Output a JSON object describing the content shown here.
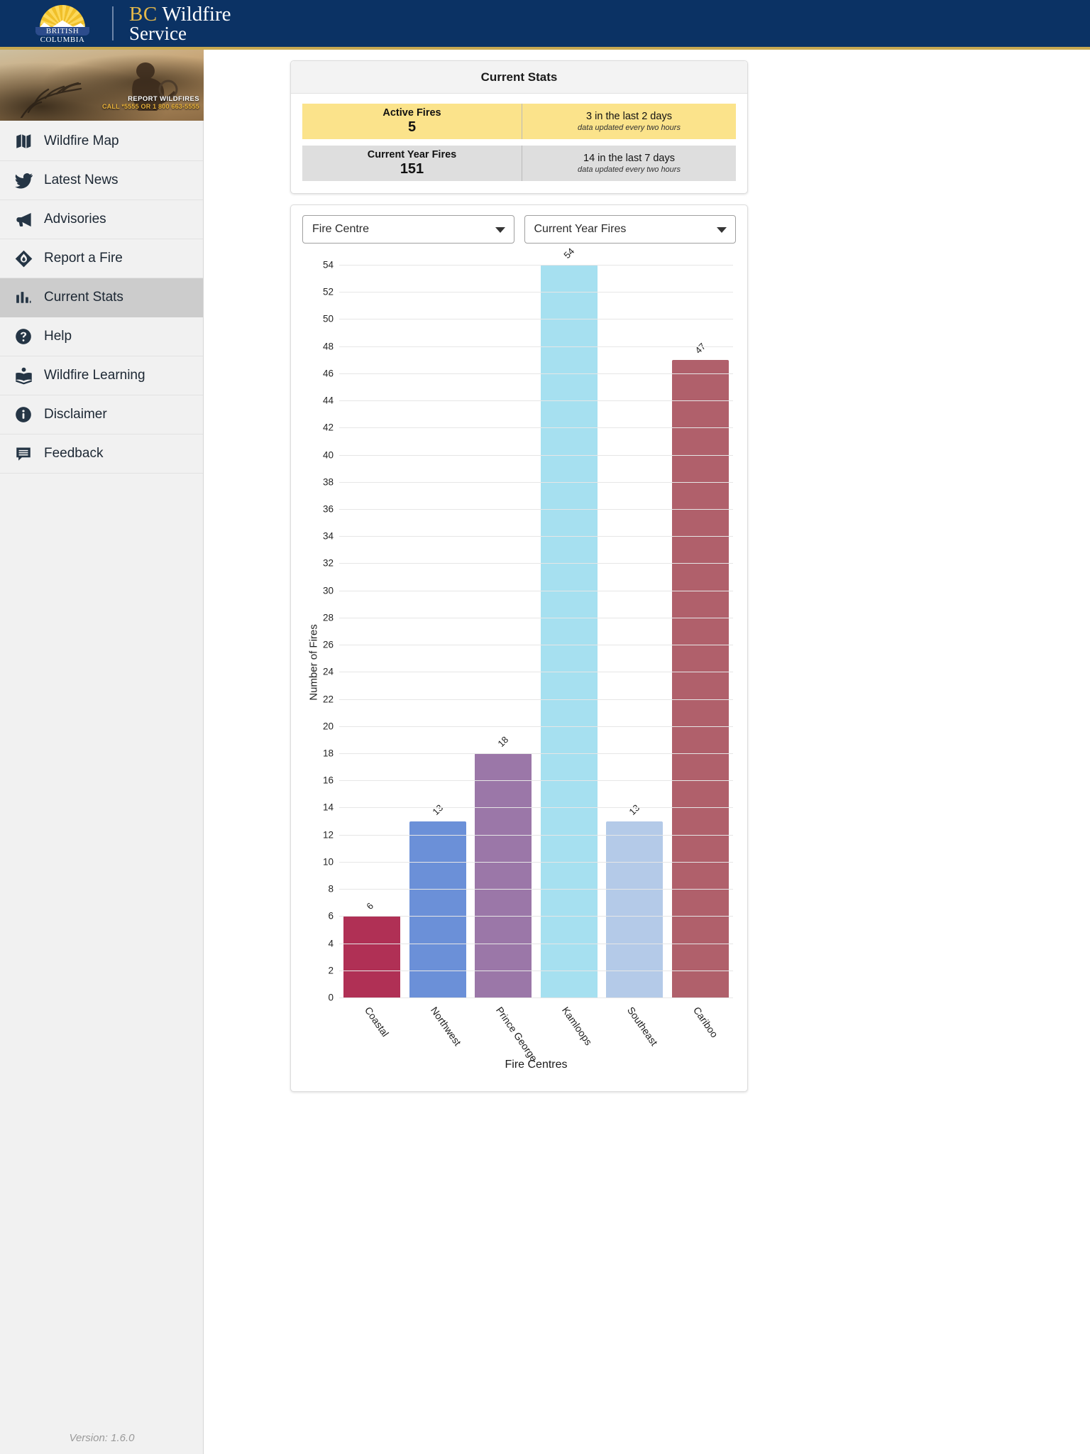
{
  "header": {
    "crest_line1": "BRITISH",
    "crest_line2": "COLUMBIA",
    "wordmark_bc": "BC",
    "wordmark_wildfire": "Wildfire",
    "wordmark_service": "Service"
  },
  "sidebar": {
    "banner": {
      "line1": "REPORT WILDFIRES",
      "line2": "CALL *5555 OR 1 800 663-5555"
    },
    "items": [
      {
        "label": "Wildfire Map",
        "icon": "map-icon",
        "active": false
      },
      {
        "label": "Latest News",
        "icon": "twitter-bird-icon",
        "active": false
      },
      {
        "label": "Advisories",
        "icon": "megaphone-icon",
        "active": false
      },
      {
        "label": "Report a Fire",
        "icon": "fire-diamond-icon",
        "active": false
      },
      {
        "label": "Current Stats",
        "icon": "bar-chart-icon",
        "active": true
      },
      {
        "label": "Help",
        "icon": "question-circle-icon",
        "active": false
      },
      {
        "label": "Wildfire Learning",
        "icon": "open-book-icon",
        "active": false
      },
      {
        "label": "Disclaimer",
        "icon": "info-circle-icon",
        "active": false
      },
      {
        "label": "Feedback",
        "icon": "comment-lines-icon",
        "active": false
      }
    ],
    "version": "Version: 1.6.0"
  },
  "stats": {
    "title": "Current Stats",
    "rows": [
      {
        "label": "Active Fires",
        "value": "5",
        "detail": "3 in the last 2 days",
        "note": "data updated every two hours",
        "color": "#fbe38b"
      },
      {
        "label": "Current Year Fires",
        "value": "151",
        "detail": "14 in the last 7 days",
        "note": "data updated every two hours",
        "color": "#dedede"
      }
    ]
  },
  "controls": {
    "group_by": "Fire Centre",
    "metric": "Current Year Fires"
  },
  "chart_data": {
    "type": "bar",
    "title": "",
    "xlabel": "Fire Centres",
    "ylabel": "Number of Fires",
    "categories": [
      "Coastal",
      "Northwest",
      "Prince George",
      "Kamloops",
      "Southeast",
      "Cariboo"
    ],
    "values": [
      6,
      13,
      18,
      54,
      13,
      47
    ],
    "colors": [
      "#b03055",
      "#6b90d8",
      "#9b77a8",
      "#a6e0f0",
      "#b4cae8",
      "#b0606b"
    ],
    "ylim": [
      0,
      54
    ],
    "ytick_step": 2,
    "yticks": [
      0,
      2,
      4,
      6,
      8,
      10,
      12,
      14,
      16,
      18,
      20,
      22,
      24,
      26,
      28,
      30,
      32,
      34,
      36,
      38,
      40,
      42,
      44,
      46,
      48,
      50,
      52,
      54
    ],
    "grid": true,
    "legend": "none",
    "data_labels": true
  }
}
